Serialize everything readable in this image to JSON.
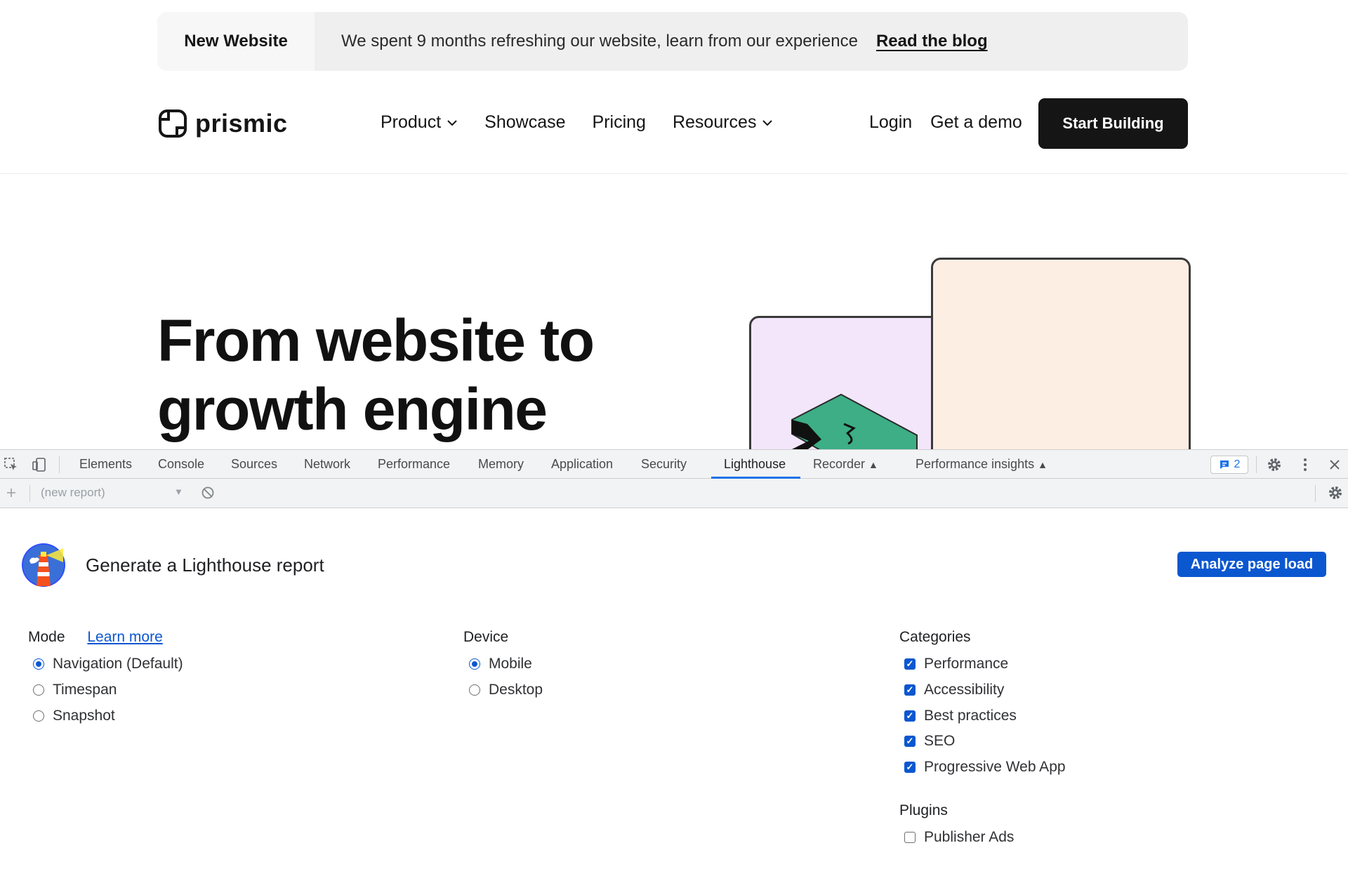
{
  "site": {
    "banner": {
      "tag": "New Website",
      "message": "We spent 9 months refreshing our website, learn from our experience",
      "link": "Read the blog"
    },
    "nav": {
      "logo_text": "prismic",
      "links": [
        "Product",
        "Showcase",
        "Pricing",
        "Resources"
      ],
      "login": "Login",
      "demo": "Get a demo",
      "cta": "Start Building"
    },
    "hero": {
      "title_line1": "From website to",
      "title_line2": "growth engine"
    }
  },
  "devtools": {
    "tabs": [
      "Elements",
      "Console",
      "Sources",
      "Network",
      "Performance",
      "Memory",
      "Application",
      "Security",
      "Lighthouse",
      "Recorder",
      "Performance insights"
    ],
    "active_tab": "Lighthouse",
    "message_count": "2",
    "report_select": "(new report)",
    "lighthouse": {
      "title": "Generate a Lighthouse report",
      "analyze_button": "Analyze page load",
      "mode": {
        "label": "Mode",
        "learn_more": "Learn more",
        "options": [
          "Navigation (Default)",
          "Timespan",
          "Snapshot"
        ],
        "selected": "Navigation (Default)"
      },
      "device": {
        "label": "Device",
        "options": [
          "Mobile",
          "Desktop"
        ],
        "selected": "Mobile"
      },
      "categories": {
        "label": "Categories",
        "items": [
          "Performance",
          "Accessibility",
          "Best practices",
          "SEO",
          "Progressive Web App"
        ],
        "checked": [
          true,
          true,
          true,
          true,
          true
        ]
      },
      "plugins": {
        "label": "Plugins",
        "items": [
          "Publisher Ads"
        ],
        "checked": [
          false
        ]
      }
    }
  },
  "colors": {
    "accent": "#0b57d0",
    "devtools_active_tab": "#1a73e8",
    "cta_background": "#151515",
    "hero_card_purple": "#f3e6fb",
    "hero_card_peach": "#fdeee4",
    "hero_shape": "#3dae86"
  }
}
